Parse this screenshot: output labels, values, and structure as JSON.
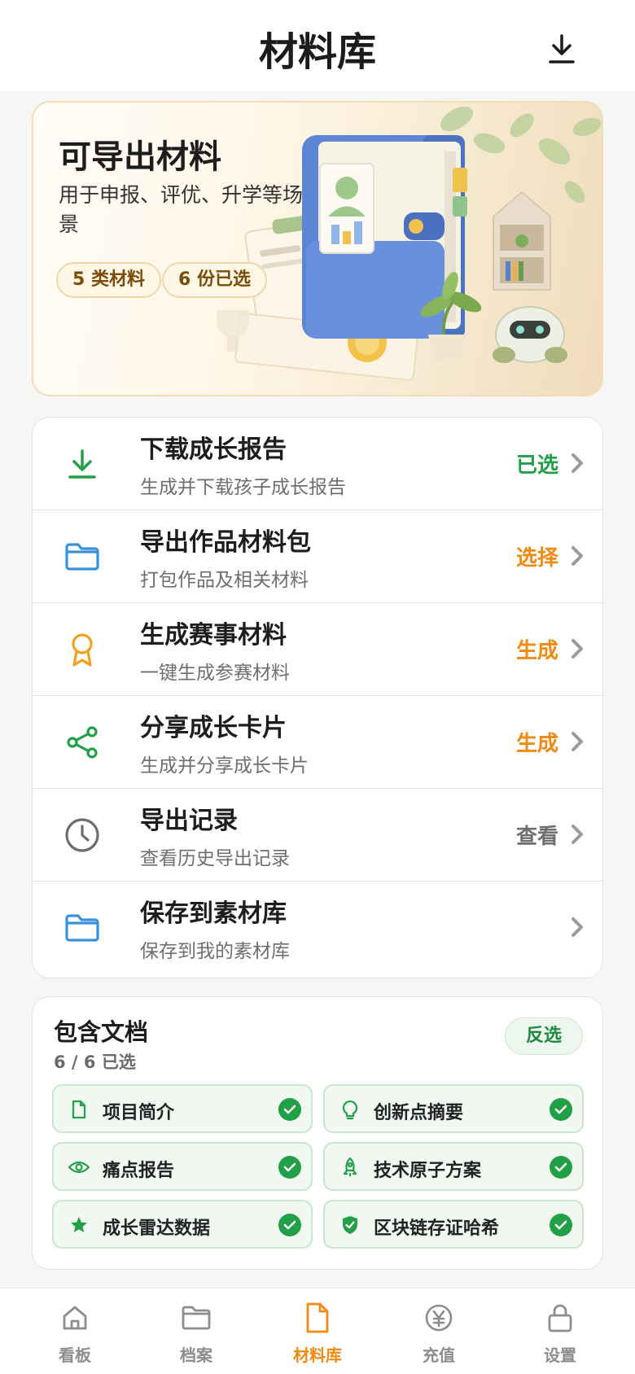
{
  "header": {
    "title": "材料库",
    "download_icon": "download-icon"
  },
  "banner": {
    "title": "可导出材料",
    "subtitle": "用于申报、评优、升学等场景",
    "pills": [
      "5 类材料",
      "6 份已选"
    ]
  },
  "actions": [
    {
      "title": "下载成长报告",
      "desc": "生成并下载孩子成长报告",
      "action": "已选",
      "action_color": "#21a048",
      "icon": "download-icon",
      "icon_color": "#21a048"
    },
    {
      "title": "导出作品材料包",
      "desc": "打包作品及相关材料",
      "action": "选择",
      "action_color": "#f08a12",
      "icon": "folder-icon",
      "icon_color": "#3a8fd9"
    },
    {
      "title": "生成赛事材料",
      "desc": "一键生成参赛材料",
      "action": "生成",
      "action_color": "#f08a12",
      "icon": "award-icon",
      "icon_color": "#f0a21e"
    },
    {
      "title": "分享成长卡片",
      "desc": "生成并分享成长卡片",
      "action": "生成",
      "action_color": "#f08a12",
      "icon": "share-icon",
      "icon_color": "#21a048"
    },
    {
      "title": "导出记录",
      "desc": "查看历史导出记录",
      "action": "查看",
      "action_color": "#6e6e6e",
      "icon": "clock-icon",
      "icon_color": "#6e6e6e"
    },
    {
      "title": "保存到素材库",
      "desc": "保存到我的素材库",
      "action": "",
      "action_color": "#6e6e6e",
      "icon": "folder-icon",
      "icon_color": "#3a8fd9"
    }
  ],
  "documents": {
    "title": "包含文档",
    "count": "6 / 6 已选",
    "invert_label": "反选",
    "items": [
      {
        "label": "项目简介",
        "icon": "document-icon",
        "checked": true
      },
      {
        "label": "创新点摘要",
        "icon": "lightbulb-icon",
        "checked": true
      },
      {
        "label": "痛点报告",
        "icon": "eye-icon",
        "checked": true
      },
      {
        "label": "技术原子方案",
        "icon": "rocket-icon",
        "checked": true
      },
      {
        "label": "成长雷达数据",
        "icon": "star-icon",
        "checked": true
      },
      {
        "label": "区块链存证哈希",
        "icon": "shield-check-icon",
        "checked": true
      }
    ]
  },
  "tabs": [
    {
      "label": "看板",
      "icon": "home-icon",
      "active": false
    },
    {
      "label": "档案",
      "icon": "folder-icon",
      "active": false
    },
    {
      "label": "材料库",
      "icon": "document-icon",
      "active": true
    },
    {
      "label": "充值",
      "icon": "yuan-icon",
      "active": false
    },
    {
      "label": "设置",
      "icon": "lock-icon",
      "active": false
    }
  ],
  "colors": {
    "accent": "#f08a12",
    "success": "#21a048",
    "info": "#3a8fd9"
  }
}
